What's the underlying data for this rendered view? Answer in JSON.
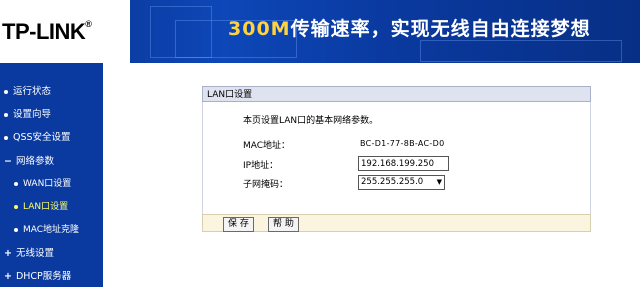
{
  "header": {
    "logo_text": "TP-LINK",
    "logo_mark": "®",
    "slogan_highlight": "300M",
    "slogan_rest": "传输速率，实现无线自由连接梦想"
  },
  "sidebar": {
    "items": [
      {
        "label": "运行状态",
        "level": 1,
        "active": false,
        "marker": "dot"
      },
      {
        "label": "设置向导",
        "level": 1,
        "active": false,
        "marker": "dot"
      },
      {
        "label": "QSS安全设置",
        "level": 1,
        "active": false,
        "marker": "dot"
      },
      {
        "label": "网络参数",
        "level": 1,
        "active": false,
        "marker": "minus"
      },
      {
        "label": "WAN口设置",
        "level": 2,
        "active": false,
        "marker": "dot"
      },
      {
        "label": "LAN口设置",
        "level": 2,
        "active": true,
        "marker": "dot"
      },
      {
        "label": "MAC地址克隆",
        "level": 2,
        "active": false,
        "marker": "dot"
      },
      {
        "label": "无线设置",
        "level": 1,
        "active": false,
        "marker": "plus"
      },
      {
        "label": "DHCP服务器",
        "level": 1,
        "active": false,
        "marker": "plus"
      }
    ]
  },
  "panel": {
    "title": "LAN口设置",
    "description": "本页设置LAN口的基本网络参数。",
    "mac_label": "MAC地址：",
    "mac_value": "BC-D1-77-8B-AC-D0",
    "ip_label": "IP地址：",
    "ip_value": "192.168.199.250",
    "mask_label": "子网掩码：",
    "mask_value": "255.255.255.0",
    "save_label": "保 存",
    "help_label": "帮 助"
  },
  "colors": {
    "banner": "#0d47b8",
    "sidebar": "#0a3aa0",
    "active_item": "#ffff66",
    "footer": "#fbf4df"
  }
}
